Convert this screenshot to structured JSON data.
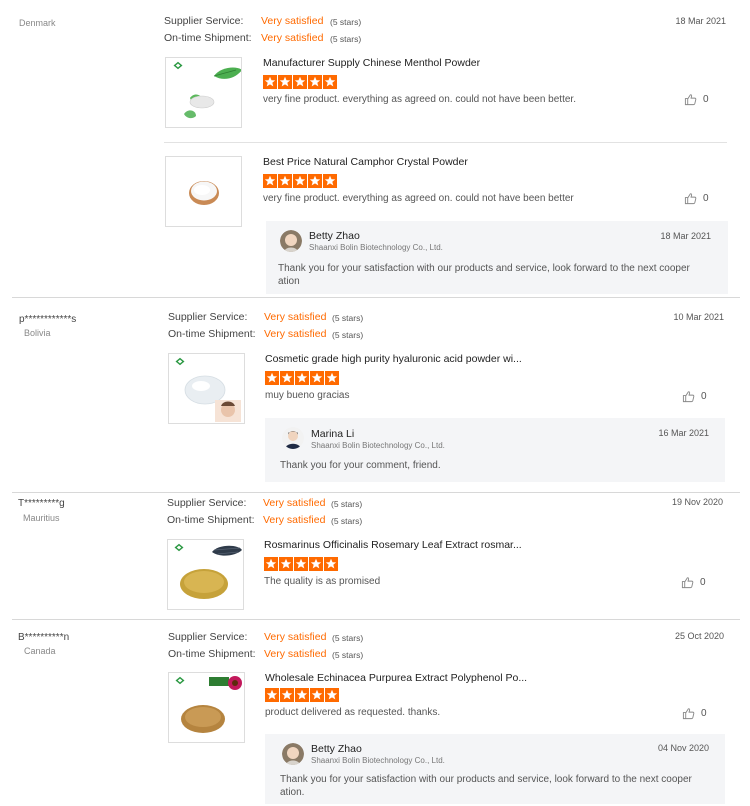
{
  "labels": {
    "supplier_service": "Supplier Service:",
    "ontime_shipment": "On-time Shipment:"
  },
  "colors": {
    "accent": "#ff6a00",
    "reply_bg": "#f4f5f7"
  },
  "reviews": [
    {
      "buyer": "",
      "country": "Denmark",
      "supplier_service": "Very satisfied",
      "supplier_stars": "(5 stars)",
      "shipment": "Very satisfied",
      "shipment_stars": "(5 stars)",
      "date": "18 Mar 2021",
      "items": [
        {
          "product": "Manufacturer Supply Chinese Menthol Powder",
          "rating": 5,
          "comment": "very fine product. everything as agreed on. could not have been better.",
          "likes": "0",
          "image_icon": "menthol-product-image"
        },
        {
          "product": "Best Price Natural Camphor Crystal Powder",
          "rating": 5,
          "comment": "very fine product. everything as agreed on. could not have been better",
          "likes": "0",
          "image_icon": "camphor-product-image"
        }
      ],
      "reply": {
        "name": "Betty Zhao",
        "company": "Shaanxi Bolin Biotechnology Co., Ltd.",
        "date": "18 Mar 2021",
        "text": "Thank you for your satisfaction with our products and service, look forward to the next cooper",
        "text2": "ation"
      }
    },
    {
      "buyer": "p************s",
      "country": "Bolivia",
      "supplier_service": "Very satisfied",
      "supplier_stars": "(5 stars)",
      "shipment": "Very satisfied",
      "shipment_stars": "(5 stars)",
      "date": "10 Mar 2021",
      "items": [
        {
          "product": "Cosmetic grade high purity hyaluronic acid powder wi...",
          "rating": 5,
          "comment": "muy bueno gracias",
          "likes": "0",
          "image_icon": "hyaluronic-product-image"
        }
      ],
      "reply": {
        "name": "Marina Li",
        "company": "Shaanxi Bolin Biotechnology Co., Ltd.",
        "date": "16 Mar 2021",
        "text": "Thank you for your comment, friend."
      }
    },
    {
      "buyer": "T*********g",
      "country": "Mauritius",
      "supplier_service": "Very satisfied",
      "supplier_stars": "(5 stars)",
      "shipment": "Very satisfied",
      "shipment_stars": "(5 stars)",
      "date": "19 Nov 2020",
      "items": [
        {
          "product": "Rosmarinus Officinalis Rosemary Leaf Extract rosmar...",
          "rating": 5,
          "comment": "The quality is as promised",
          "likes": "0",
          "image_icon": "rosemary-product-image"
        }
      ]
    },
    {
      "buyer": "B**********n",
      "country": "Canada",
      "supplier_service": "Very satisfied",
      "supplier_stars": "(5 stars)",
      "shipment": "Very satisfied",
      "shipment_stars": "(5 stars)",
      "date": "25 Oct 2020",
      "items": [
        {
          "product": "Wholesale Echinacea Purpurea Extract Polyphenol Po...",
          "rating": 5,
          "comment": "product delivered as requested.   thanks.",
          "likes": "0",
          "image_icon": "echinacea-product-image"
        }
      ],
      "reply": {
        "name": "Betty Zhao",
        "company": "Shaanxi Bolin Biotechnology Co., Ltd.",
        "date": "04 Nov 2020",
        "text": "Thank you for your satisfaction with our products and service, look forward to the next cooper",
        "text2": "ation."
      }
    }
  ]
}
